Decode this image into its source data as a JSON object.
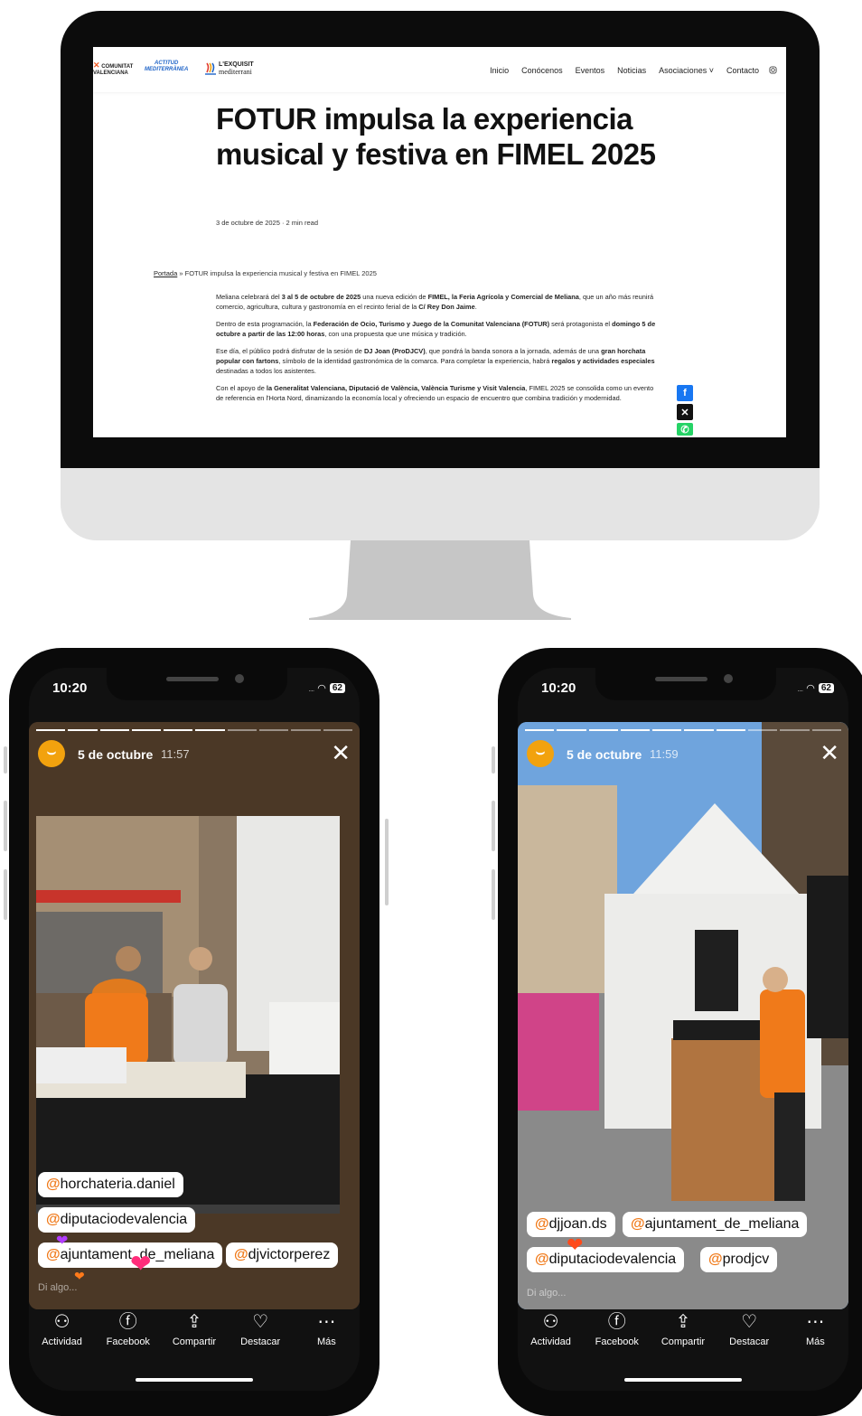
{
  "site": {
    "logos": {
      "cv_line1": "COMUNITAT",
      "cv_line2": "VALENCIANA",
      "am_line1": "ACTITUD",
      "am_line2": "MEDITERRÀNEA",
      "lem_line1": "L'EXQUISIT",
      "lem_line2": "mediterrani"
    },
    "nav": [
      "Inicio",
      "Conócenos",
      "Eventos",
      "Noticias",
      "Asociaciones ˅",
      "Contacto"
    ],
    "article": {
      "title": "FOTUR impulsa la experiencia musical y festiva en FIMEL 2025",
      "meta": "3 de octubre de 2025  ·  2 min read",
      "breadcrumb_link": "Portada",
      "breadcrumb_rest": " » FOTUR impulsa la experiencia musical y festiva en FIMEL 2025",
      "p1": [
        "Meliana celebrará del ",
        "3 al 5 de octubre de 2025",
        " una nueva edición de ",
        "FIMEL, la Feria Agrícola y Comercial de Meliana",
        ", que un año más reunirá comercio, agricultura, cultura y gastronomía en el recinto ferial de la ",
        "C/ Rey Don Jaime",
        "."
      ],
      "p2": [
        "Dentro de esta programación, la ",
        "Federación de Ocio, Turismo y Juego de la Comunitat Valenciana (FOTUR)",
        " será protagonista el ",
        "domingo 5 de octubre a partir de las 12:00 horas",
        ", con una propuesta que une música y tradición."
      ],
      "p3": [
        "Ese día, el público podrá disfrutar de la sesión de ",
        "DJ Joan (ProDJCV)",
        ", que pondrá la banda sonora a la jornada, además de una ",
        "gran horchata popular con fartons",
        ", símbolo de la identidad gastronómica de la comarca. Para completar la experiencia, habrá ",
        "regalos y actividades especiales",
        " destinadas a todos los asistentes."
      ],
      "p4": [
        "Con el apoyo de ",
        "la Generalitat Valenciana, Diputació de València, València Turisme y Visit Valencia",
        ", FIMEL 2025 se consolida como un evento de referencia en l'Horta Nord, dinamizando la economía local y ofreciendo un espacio de encuentro que combina tradición y modernidad."
      ]
    },
    "share": [
      "facebook-icon",
      "x-icon",
      "whatsapp-icon"
    ]
  },
  "phones": [
    {
      "time": "10:20",
      "battery": "62",
      "story_date": "5 de octubre",
      "story_time": "11:57",
      "tags": [
        "horchateria.daniel",
        "diputaciodevalencia",
        "ajuntament_de_meliana",
        "djvictorperez"
      ],
      "say_placeholder": "Di algo...",
      "actions": [
        "Actividad",
        "Facebook",
        "Compartir",
        "Destacar",
        "Más"
      ]
    },
    {
      "time": "10:20",
      "battery": "62",
      "story_date": "5 de octubre",
      "story_time": "11:59",
      "tags": [
        "djjoan.ds",
        "ajuntament_de_meliana",
        "diputaciodevalencia",
        "prodjcv"
      ],
      "say_placeholder": "Di algo...",
      "actions": [
        "Actividad",
        "Facebook",
        "Compartir",
        "Destacar",
        "Más"
      ]
    }
  ],
  "colors": {
    "facebook": "#1877f2",
    "x": "#111111",
    "whatsapp": "#25d366",
    "story_avatar": "#f2a20e",
    "tag_at": "#f07a1a",
    "heart_pink": "#ff2d7a",
    "heart_purple": "#b23cff",
    "heart_orange": "#ff7a1a"
  }
}
